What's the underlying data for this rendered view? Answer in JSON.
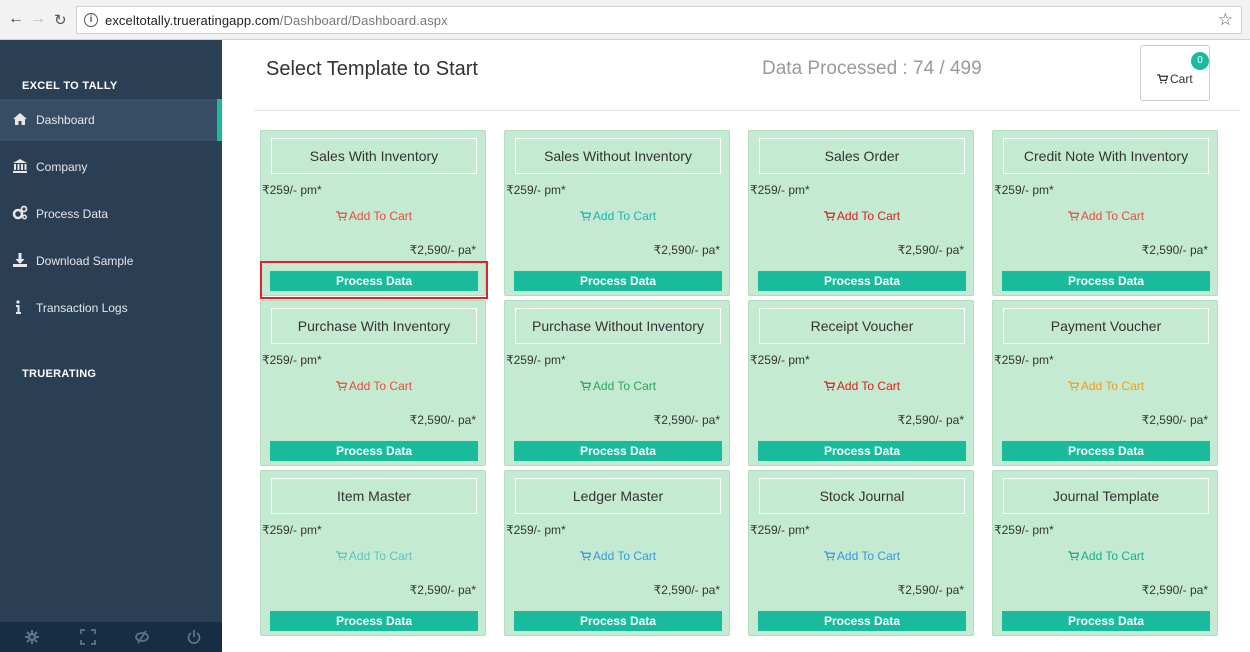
{
  "browser": {
    "url_host": "exceltotally.trueratingapp.com",
    "url_path": "/Dashboard/Dashboard.aspx"
  },
  "sidebar": {
    "section1": "EXCEL TO TALLY",
    "section2": "TRUERATING",
    "items": [
      {
        "label": "Dashboard",
        "icon": "home-icon"
      },
      {
        "label": "Company",
        "icon": "bank-icon"
      },
      {
        "label": "Process Data",
        "icon": "gears-icon"
      },
      {
        "label": "Download Sample",
        "icon": "download-icon"
      },
      {
        "label": "Transaction Logs",
        "icon": "info-icon"
      }
    ],
    "footer_icons": [
      "settings-icon",
      "fullscreen-icon",
      "eye-slash-icon",
      "power-icon"
    ]
  },
  "header": {
    "title": "Select Template to Start",
    "processed": "Data Processed : 74 / 499",
    "cart_label": "Cart",
    "cart_count": "0"
  },
  "cards": [
    {
      "name": "Sales With Inventory",
      "pm": "₹259/- pm*",
      "atc": "Add To Cart",
      "pa": "₹2,590/- pa*",
      "btn": "Process Data",
      "color": "#e74c3c"
    },
    {
      "name": "Sales Without Inventory",
      "pm": "₹259/- pm*",
      "atc": "Add To Cart",
      "pa": "₹2,590/- pa*",
      "btn": "Process Data",
      "color": "#1ab3b3"
    },
    {
      "name": "Sales Order",
      "pm": "₹259/- pm*",
      "atc": "Add To Cart",
      "pa": "₹2,590/- pa*",
      "btn": "Process Data",
      "color": "#d91e18"
    },
    {
      "name": "Credit Note With Inventory",
      "pm": "₹259/- pm*",
      "atc": "Add To Cart",
      "pa": "₹2,590/- pa*",
      "btn": "Process Data",
      "color": "#e74c3c"
    },
    {
      "name": "Purchase With Inventory",
      "pm": "₹259/- pm*",
      "atc": "Add To Cart",
      "pa": "₹2,590/- pa*",
      "btn": "Process Data",
      "color": "#e74c3c"
    },
    {
      "name": "Purchase Without Inventory",
      "pm": "₹259/- pm*",
      "atc": "Add To Cart",
      "pa": "₹2,590/- pa*",
      "btn": "Process Data",
      "color": "#26a65b"
    },
    {
      "name": "Receipt Voucher",
      "pm": "₹259/- pm*",
      "atc": "Add To Cart",
      "pa": "₹2,590/- pa*",
      "btn": "Process Data",
      "color": "#d91e18"
    },
    {
      "name": "Payment Voucher",
      "pm": "₹259/- pm*",
      "atc": "Add To Cart",
      "pa": "₹2,590/- pa*",
      "btn": "Process Data",
      "color": "#f39c12"
    },
    {
      "name": "Item Master",
      "pm": "₹259/- pm*",
      "atc": "Add To Cart",
      "pa": "₹2,590/- pa*",
      "btn": "Process Data",
      "color": "#5fc4c4"
    },
    {
      "name": "Ledger Master",
      "pm": "₹259/- pm*",
      "atc": "Add To Cart",
      "pa": "₹2,590/- pa*",
      "btn": "Process Data",
      "color": "#3498db"
    },
    {
      "name": "Stock Journal",
      "pm": "₹259/- pm*",
      "atc": "Add To Cart",
      "pa": "₹2,590/- pa*",
      "btn": "Process Data",
      "color": "#3498db"
    },
    {
      "name": "Journal Template",
      "pm": "₹259/- pm*",
      "atc": "Add To Cart",
      "pa": "₹2,590/- pa*",
      "btn": "Process Data",
      "color": "#1aaa8f"
    }
  ],
  "colors": {
    "accent": "#1abb9c",
    "sidebar": "#2a3f54",
    "card": "#c4ebd2",
    "highlight": "#d9262c"
  }
}
